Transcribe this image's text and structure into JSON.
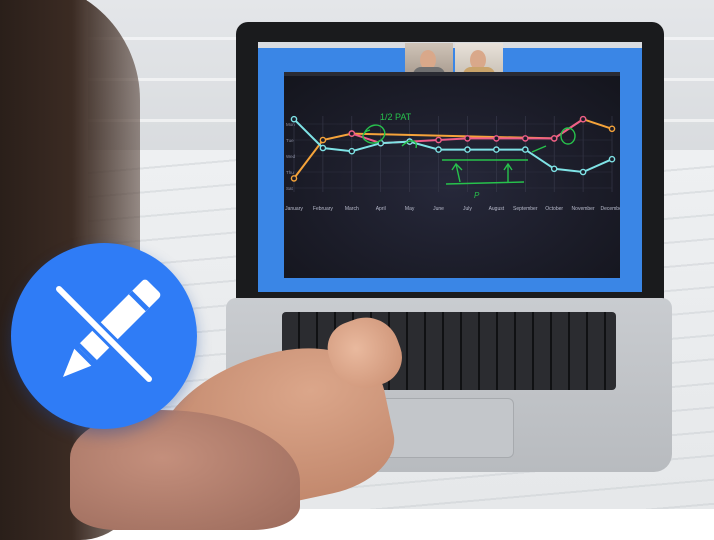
{
  "screen_chart": {
    "months": [
      "January",
      "February",
      "March",
      "April",
      "May",
      "June",
      "July",
      "August",
      "September",
      "October",
      "November",
      "December"
    ],
    "y_labels": [
      "Mon",
      "Tue",
      "Wed",
      "Thu",
      "Sat"
    ],
    "annotation_text": "1/2 PAT",
    "annotation_marks": [
      "P"
    ]
  },
  "colors": {
    "badge": "#2f7cf6",
    "orange_line": "#f5a33a",
    "pink_line": "#ef5d8a",
    "cyan_line": "#7fe3e6",
    "annotation": "#27c24c"
  },
  "icons": {
    "badge_icon": "pencil-crossed-icon"
  }
}
